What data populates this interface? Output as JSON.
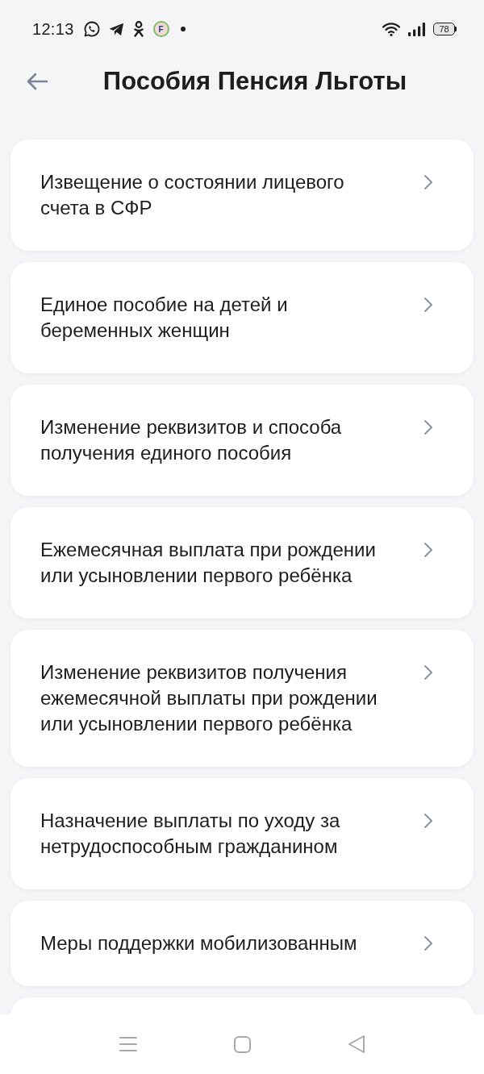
{
  "status_bar": {
    "time": "12:13",
    "app_icon_label": "F",
    "battery": "78"
  },
  "header": {
    "title": "Пособия Пенсия Льготы"
  },
  "list": {
    "items": [
      {
        "title": "Извещение о состоянии лицевого счета в СФР"
      },
      {
        "title": "Единое пособие на детей и беременных женщин"
      },
      {
        "title": "Изменение реквизитов и способа получения единого пособия"
      },
      {
        "title": "Ежемесячная выплата при рождении или усыновлении первого ребёнка"
      },
      {
        "title": "Изменение реквизитов получения ежемесячной выплаты при рождении или усыновлении первого ребёнка"
      },
      {
        "title": "Назначение выплаты по уходу за нетрудоспособным гражданином"
      },
      {
        "title": "Меры поддержки мобилизованным"
      }
    ],
    "has_more": true
  }
}
